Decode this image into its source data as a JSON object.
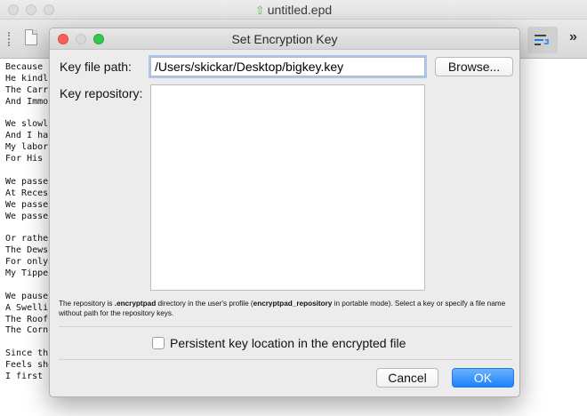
{
  "window": {
    "title": "untitled.epd",
    "doc_icon": "up-arrow-icon"
  },
  "toolbar": {
    "icons": [
      "grip-handle-icon",
      "new-document-icon",
      "word-wrap-icon",
      "overflow-chevron-icon"
    ],
    "more_glyph": "»"
  },
  "editor": {
    "lines": [
      "Because",
      "He kindl",
      "The Carr",
      "And Immo",
      "",
      "We slowl",
      "And I ha",
      "My labor",
      "For His",
      "",
      "We passe",
      "At Reces",
      "We passe",
      "We passe",
      "",
      "Or rathe",
      "The Dews",
      "For only",
      "My Tippe",
      "",
      "We pause",
      "A Swelli",
      "The Roof",
      "The Corn",
      "",
      "Since th",
      "Feels shorter than the Day",
      "I first surmised the Horses' Heads"
    ]
  },
  "dialog": {
    "title": "Set Encryption Key",
    "key_file_label": "Key file path:",
    "key_file_value": "/Users/skickar/Desktop/bigkey.key",
    "browse_label": "Browse...",
    "repository_label": "Key repository:",
    "repository_items": [],
    "help_text": {
      "p1": "The repository is ",
      "b1": ".encryptpad",
      "p2": " directory in the user's profile (",
      "b2": "encryptpad_repository",
      "p3": " in portable mode). Select a key or specify a file name without path for the repository keys."
    },
    "persistent_label": "Persistent key location in the encrypted file",
    "persistent_checked": false,
    "cancel_label": "Cancel",
    "ok_label": "OK"
  },
  "colors": {
    "ok_button": "#1a82fb",
    "close_dot": "#fc605c",
    "zoom_dot": "#34c84a",
    "doc_icon": "#5cb85c"
  }
}
